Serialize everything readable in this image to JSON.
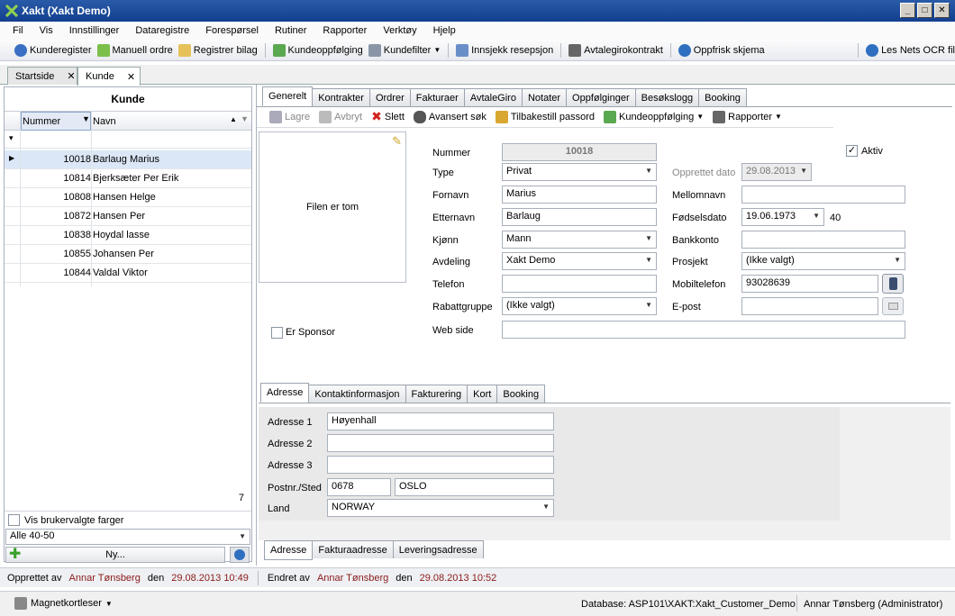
{
  "window": {
    "title": "Xakt (Xakt Demo)",
    "min": "_",
    "max": "□",
    "close": "✕"
  },
  "menu": [
    "Fil",
    "Vis",
    "Innstillinger",
    "Dataregistre",
    "Forespørsel",
    "Rutiner",
    "Rapporter",
    "Verktøy",
    "Hjelp"
  ],
  "toolbar": [
    "Kunderegister",
    "Manuell ordre",
    "Registrer bilag",
    "Kundeoppfølging",
    "Kundefilter",
    "Innsjekk resepsjon",
    "Avtalegirokontrakt",
    "Oppfrisk skjema",
    "Les Nets OCR fil"
  ],
  "doc_tabs": [
    "Startside",
    "Kunde"
  ],
  "left": {
    "title": "Kunde",
    "col_number": "Nummer",
    "col_name": "Navn",
    "rows": [
      {
        "num": "10018",
        "name": "Barlaug Marius"
      },
      {
        "num": "10814",
        "name": "Bjerksæter Per Erik"
      },
      {
        "num": "10808",
        "name": "Hansen Helge"
      },
      {
        "num": "10872",
        "name": "Hansen Per"
      },
      {
        "num": "10838",
        "name": "Hoydal lasse"
      },
      {
        "num": "10855",
        "name": "Johansen Per"
      },
      {
        "num": "10844",
        "name": "Valdal Viktor"
      }
    ],
    "count": "7",
    "custom_colors": "Vis brukervalgte farger",
    "filter": "Alle 40-50",
    "new_button": "Ny..."
  },
  "tabs": [
    "Generelt",
    "Kontrakter",
    "Ordrer",
    "Fakturaer",
    "AvtaleGiro",
    "Notater",
    "Oppfølginger",
    "Besøkslogg",
    "Booking"
  ],
  "subtoolbar": [
    "Lagre",
    "Avbryt",
    "Slett",
    "Avansert søk",
    "Tilbakestill passord",
    "Kundeoppfølging",
    "Rapporter"
  ],
  "form": {
    "image_text": "Filen er tom",
    "sponsor": "Er Sponsor",
    "labels": {
      "nummer": "Nummer",
      "type": "Type",
      "fornavn": "Fornavn",
      "etternavn": "Etternavn",
      "kjonn": "Kjønn",
      "avdeling": "Avdeling",
      "telefon": "Telefon",
      "rabattgruppe": "Rabattgruppe",
      "webside": "Web side",
      "aktiv": "Aktiv",
      "opprettet_dato": "Opprettet dato",
      "mellomnavn": "Mellomnavn",
      "fodselsdato": "Fødselsdato",
      "bankkonto": "Bankkonto",
      "prosjekt": "Prosjekt",
      "mobiltelefon": "Mobiltelefon",
      "epost": "E-post"
    },
    "values": {
      "nummer": "10018",
      "type": "Privat",
      "fornavn": "Marius",
      "etternavn": "Barlaug",
      "kjonn": "Mann",
      "avdeling": "Xakt Demo",
      "telefon": "",
      "rabattgruppe": "(Ikke valgt)",
      "webside": "",
      "opprettet_dato": "29.08.2013",
      "mellomnavn": "",
      "fodselsdato": "19.06.1973",
      "alder": "40",
      "bankkonto": "",
      "prosjekt": "(Ikke valgt)",
      "mobiltelefon": "93028639",
      "epost": ""
    }
  },
  "addr_tabs": [
    "Adresse",
    "Kontaktinformasjon",
    "Fakturering",
    "Kort",
    "Booking"
  ],
  "address": {
    "labels": [
      "Adresse 1",
      "Adresse 2",
      "Adresse 3",
      "Postnr./Sted",
      "Land"
    ],
    "adresse1": "Høyenhall",
    "adresse2": "",
    "adresse3": "",
    "postnr": "0678",
    "sted": "OSLO",
    "land": "NORWAY"
  },
  "addr_bottom_tabs": [
    "Adresse",
    "Fakturaadresse",
    "Leveringsadresse"
  ],
  "status1": {
    "created_label": "Opprettet av",
    "created_by": "Annar Tønsberg",
    "den1": "den",
    "created_at": "29.08.2013 10:49",
    "changed_label": "Endret av",
    "changed_by": "Annar Tønsberg",
    "den2": "den",
    "changed_at": "29.08.2013 10:52"
  },
  "status2": {
    "magnet": "Magnetkortleser",
    "database": "Database: ASP101\\XAKT:Xakt_Customer_Demo",
    "user": "Annar Tønsberg (Administrator)"
  }
}
